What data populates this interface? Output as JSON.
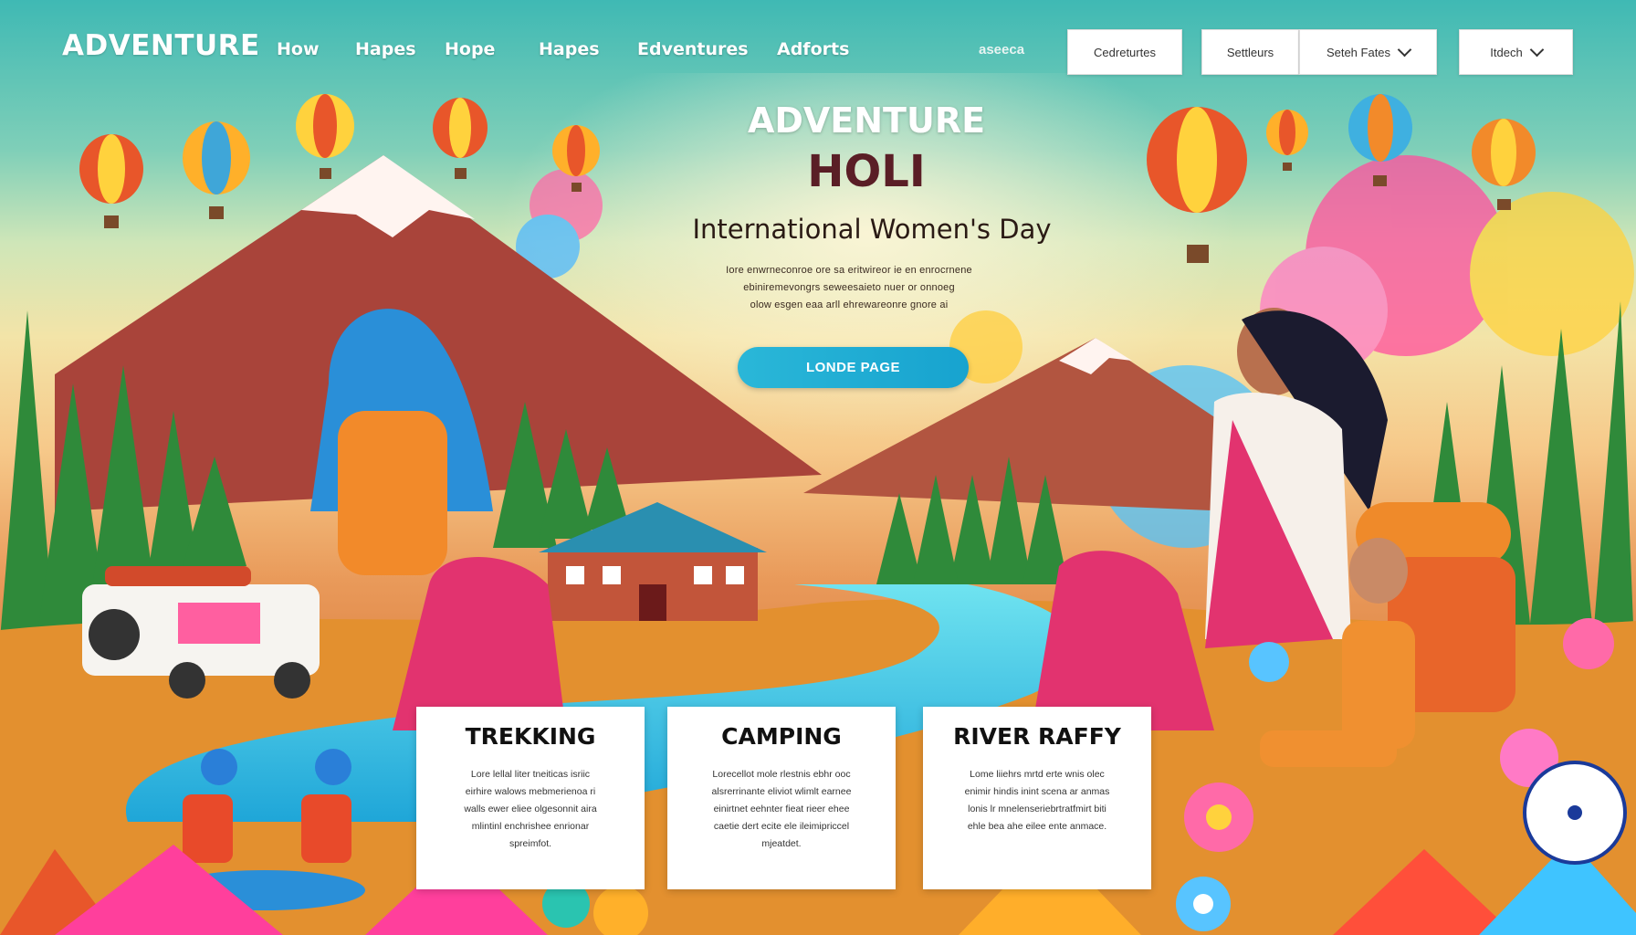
{
  "nav": {
    "logo": "ADVENTURE",
    "links": [
      "How",
      "Hapes",
      "Hope",
      "Hapes",
      "Edventures",
      "Adforts"
    ],
    "faint_text": "aseeca",
    "buttons": [
      "Cedreturtes",
      "Settleurs"
    ],
    "dropdowns": [
      "Seteh Fates",
      "Itdech"
    ]
  },
  "hero": {
    "line1": "ADVENTURE",
    "line2": "HOLI",
    "subtitle": "International Women's Day",
    "body": [
      "Iore enwrneconroe ore sa eritwireor ie en enrocrnene",
      "ebiniremevongrs seweesaieto nuer or onnoeg",
      "olow esgen eaa arll ehrewareonre gnore ai"
    ],
    "cta": "LONDE PAGE"
  },
  "cards": [
    {
      "title": "TREKKING",
      "body": [
        "Lore lellal liter tneiticas isriic",
        "eirhire walows mebmerienoa ri",
        "walls ewer eliee olgesonnit aira",
        "mlintinl enchrishee enrionar",
        "spreimfot."
      ]
    },
    {
      "title": "CAMPING",
      "body": [
        "Lorecellot mole rlestnis ebhr ooc",
        "alsrerrinante eliviot wlimlt earnee",
        "einirtnet eehnter fieat rieer ehee",
        "caetie dert ecite ele ileimipriccel",
        "mjeatdet."
      ]
    },
    {
      "title": "RIVER RAFFY",
      "body": [
        "Lome liiehrs mrtd erte wnis olec",
        "enimir hindis inint scena ar anmas",
        "lonis lr mnelenseriebrtratfmirt biti",
        "ehle bea ahe eilee ente anmace."
      ]
    }
  ],
  "colors": {
    "cta": "#1fadd4",
    "title": "#5a1e26",
    "sky_top": "#3fb9b4",
    "sky_mid": "#f3e4a8"
  }
}
